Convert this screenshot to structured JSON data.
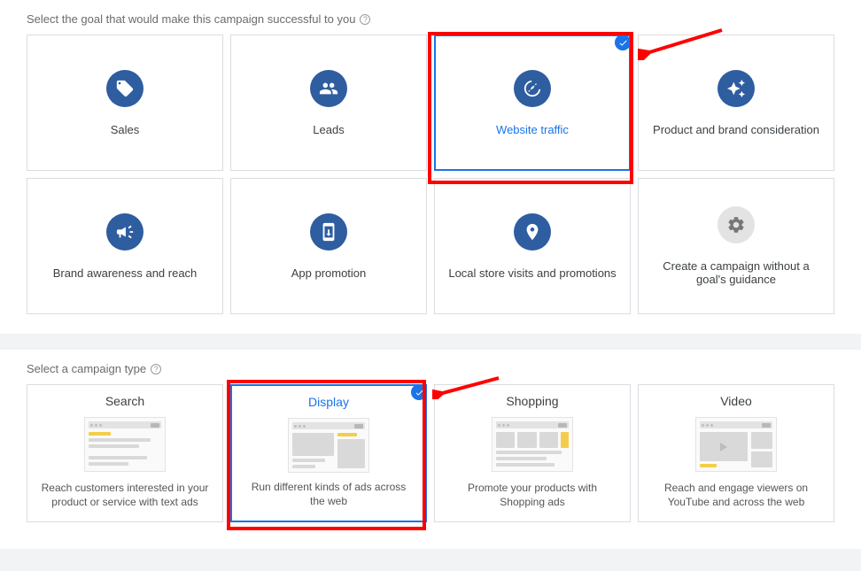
{
  "goals": {
    "title": "Select the goal that would make this campaign successful to you",
    "items": [
      {
        "id": "sales",
        "label": "Sales",
        "icon": "tag",
        "selected": false
      },
      {
        "id": "leads",
        "label": "Leads",
        "icon": "people",
        "selected": false
      },
      {
        "id": "website-traffic",
        "label": "Website traffic",
        "icon": "click",
        "selected": true
      },
      {
        "id": "brand-consideration",
        "label": "Product and brand consideration",
        "icon": "sparkle",
        "selected": false
      },
      {
        "id": "brand-awareness",
        "label": "Brand awareness and reach",
        "icon": "megaphone",
        "selected": false
      },
      {
        "id": "app-promotion",
        "label": "App promotion",
        "icon": "app",
        "selected": false
      },
      {
        "id": "local-store",
        "label": "Local store visits and promotions",
        "icon": "pin",
        "selected": false
      },
      {
        "id": "no-goal",
        "label": "Create a campaign without a goal's guidance",
        "icon": "gear",
        "selected": false,
        "muted": true
      }
    ]
  },
  "types": {
    "title": "Select a campaign type",
    "items": [
      {
        "id": "search",
        "title": "Search",
        "desc": "Reach customers interested in your product or service with text ads",
        "selected": false
      },
      {
        "id": "display",
        "title": "Display",
        "desc": "Run different kinds of ads across the web",
        "selected": true
      },
      {
        "id": "shopping",
        "title": "Shopping",
        "desc": "Promote your products with Shopping ads",
        "selected": false
      },
      {
        "id": "video",
        "title": "Video",
        "desc": "Reach and engage viewers on YouTube and across the web",
        "selected": false
      }
    ]
  }
}
